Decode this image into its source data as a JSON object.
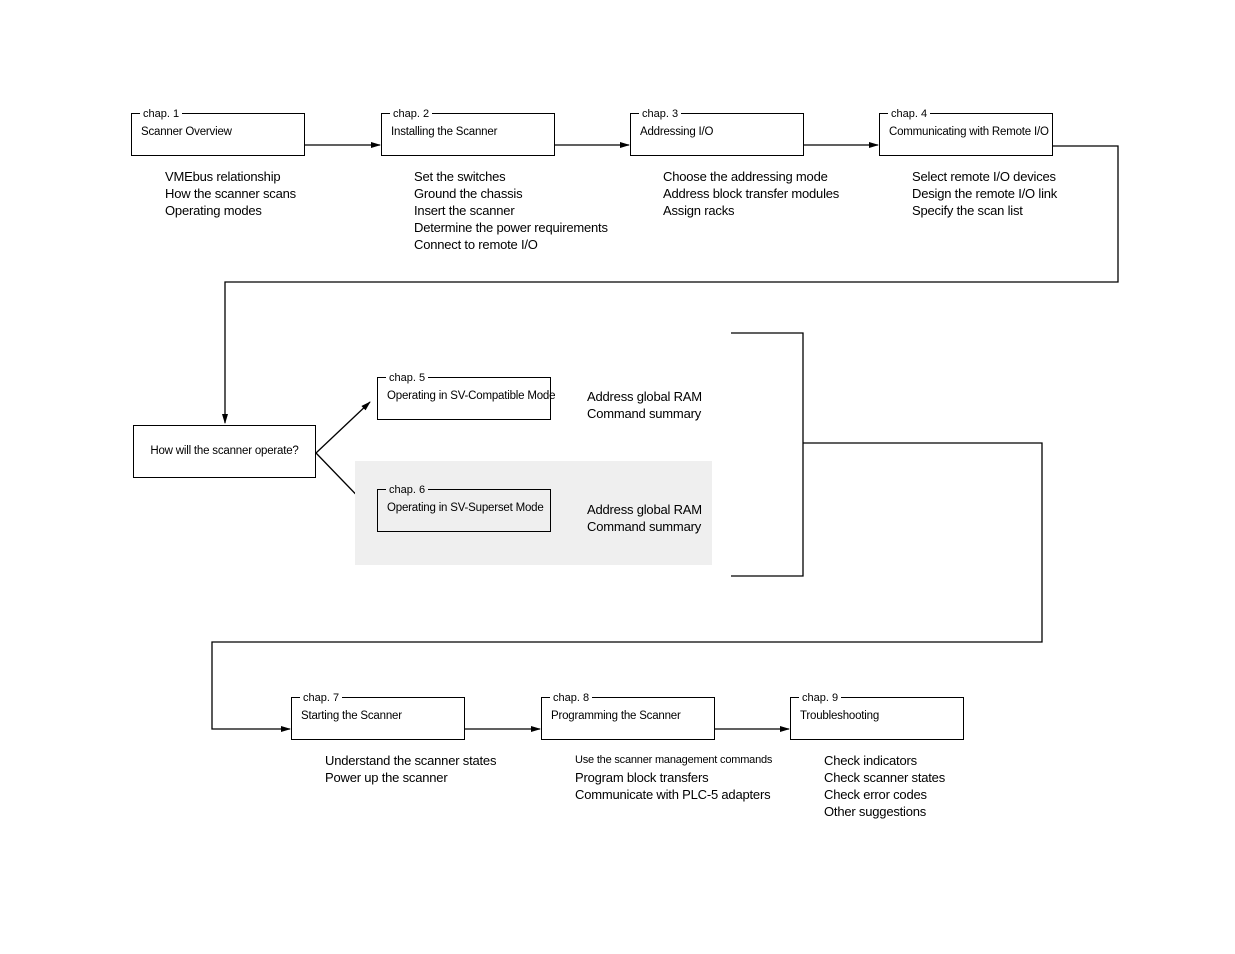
{
  "chapters": [
    {
      "chap": "chap. 1",
      "title": "Scanner Overview",
      "topics": [
        "VMEbus relationship",
        "How the scanner scans",
        "Operating modes"
      ]
    },
    {
      "chap": "chap. 2",
      "title": "Installing the Scanner",
      "topics": [
        "Set the switches",
        "Ground the chassis",
        "Insert the scanner",
        "Determine the power requirements",
        "Connect to remote I/O"
      ]
    },
    {
      "chap": "chap. 3",
      "title": "Addressing I/O",
      "topics": [
        "Choose the addressing mode",
        "Address block transfer modules",
        "Assign racks"
      ]
    },
    {
      "chap": "chap. 4",
      "title": "Communicating with Remote I/O",
      "topics": [
        "Select remote I/O devices",
        "Design the remote I/O link",
        "Specify the scan list"
      ]
    },
    {
      "chap": "chap. 5",
      "title": "Operating in SV-Compatible Mode",
      "topics": [
        "Address global RAM",
        "Command summary"
      ]
    },
    {
      "chap": "chap. 6",
      "title": "Operating in SV-Superset Mode",
      "topics": [
        "Address global RAM",
        "Command summary"
      ]
    },
    {
      "chap": "chap. 7",
      "title": "Starting the Scanner",
      "topics": [
        "Understand the scanner states",
        "Power up the scanner"
      ]
    },
    {
      "chap": "chap. 8",
      "title": "Programming the Scanner",
      "topics": [
        "Use the scanner management commands",
        "Program block transfers",
        "Communicate with PLC-5 adapters"
      ]
    },
    {
      "chap": "chap. 9",
      "title": "Troubleshooting",
      "topics": [
        "Check indicators",
        "Check scanner states",
        "Check error codes",
        "Other suggestions"
      ]
    }
  ],
  "decision": {
    "question": "How will the scanner operate?"
  },
  "colors": {
    "line": "#000000",
    "highlight": "#efefef"
  }
}
